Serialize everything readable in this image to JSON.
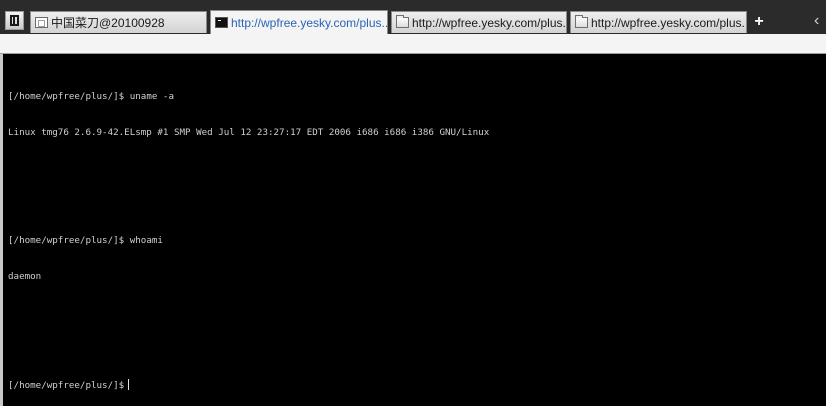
{
  "tabs": [
    {
      "label": "中国菜刀@20100928",
      "icon": "page-icon",
      "active": false
    },
    {
      "label": "http://wpfree.yesky.com/plus...",
      "icon": "terminal-icon",
      "active": true
    },
    {
      "label": "http://wpfree.yesky.com/plus...",
      "icon": "folder-icon",
      "active": false
    },
    {
      "label": "http://wpfree.yesky.com/plus...",
      "icon": "folder-icon",
      "active": false
    }
  ],
  "controls": {
    "new_tab": "+",
    "scroll_left": "‹"
  },
  "terminal": {
    "prompt": "[/home/wpfree/plus/]$",
    "commands": [
      {
        "input": "uname -a",
        "output": "Linux tmg76 2.6.9-42.ELsmp #1 SMP Wed Jul 12 23:27:17 EDT 2006 i686 i686 i386 GNU/Linux"
      },
      {
        "input": "whoami",
        "output": "daemon"
      }
    ],
    "current_input": ""
  },
  "colors": {
    "terminal_background": "#000000",
    "terminal_text": "#d0d0d0",
    "active_tab_text": "#2a63b8",
    "tabbar_background": "#2b2b2b"
  }
}
